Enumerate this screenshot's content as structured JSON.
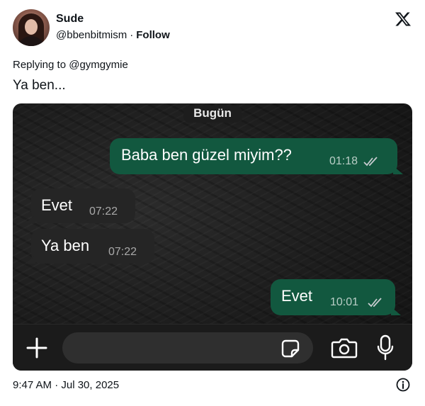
{
  "author": {
    "name": "Sude",
    "handle": "@bbenbitmism",
    "separator": "·",
    "follow_label": "Follow",
    "avatar_icon": "profile-photo"
  },
  "brand_icon": "x-logo-icon",
  "reply_line": "Replying to @gymgymie",
  "tweet_text": "Ya ben...",
  "chat": {
    "date_label": "Bugün",
    "messages": [
      {
        "direction": "outgoing",
        "text": "Baba ben güzel miyim??",
        "time": "01:18",
        "status": "read"
      },
      {
        "direction": "incoming",
        "text": "Evet",
        "time": "07:22"
      },
      {
        "direction": "incoming",
        "text": "Ya ben",
        "time": "07:22"
      },
      {
        "direction": "outgoing",
        "text": "Evet",
        "time": "10:01",
        "status": "read"
      }
    ],
    "input": {
      "value": ""
    },
    "icons": [
      "plus-icon",
      "sticker-icon",
      "camera-icon",
      "microphone-icon"
    ],
    "colors": {
      "outgoing_bubble": "#12583f",
      "incoming_bubble": "#252525",
      "ticks": "#c8ccd0"
    }
  },
  "timestamp": "9:47 AM · Jul 30, 2025",
  "info_icon": "info-icon"
}
